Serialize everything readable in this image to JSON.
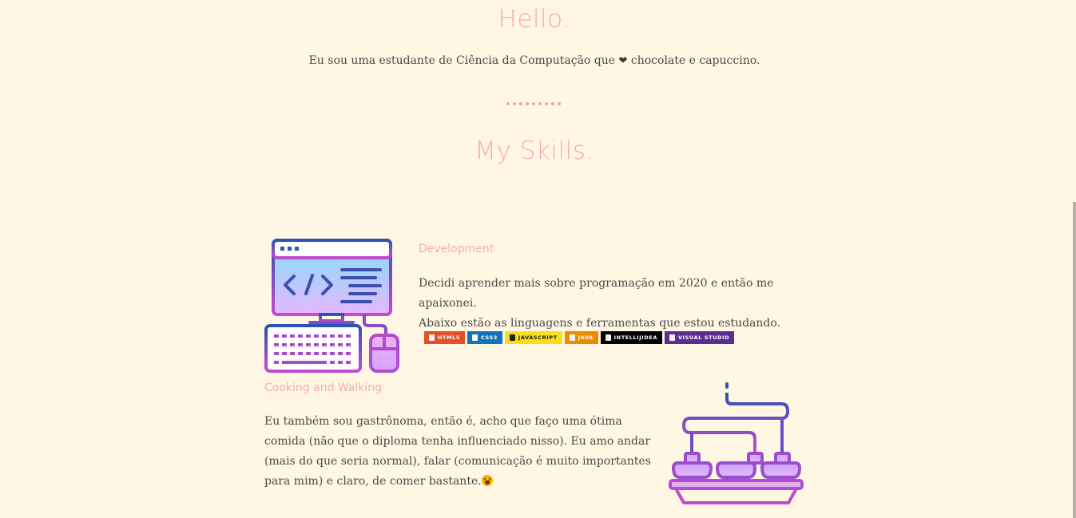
{
  "hello": {
    "title": "Hello.",
    "intro_before": "Eu sou uma estudante de Ciência da Computação que",
    "intro_heart": "❤",
    "intro_after": "chocolate e capuccino."
  },
  "skills": {
    "title": "My Skills."
  },
  "development": {
    "title": "Development",
    "line1": "Decidi aprender mais sobre programação em 2020 e então me apaixonei.",
    "line2": "Abaixo estão as linguagens e ferramentas que estou estudando.",
    "illustration_icon": "computer-code-icon",
    "badges": [
      {
        "label": "HTML5",
        "color": "#e34f26",
        "icon": "html5-icon"
      },
      {
        "label": "CSS3",
        "color": "#1572b6",
        "icon": "css3-icon"
      },
      {
        "label": "JAVASCRIPT",
        "color": "#f7df1e",
        "icon": "javascript-icon"
      },
      {
        "label": "JAVA",
        "color": "#ed8b00",
        "icon": "java-icon"
      },
      {
        "label": "INTELLIJIDEA",
        "color": "#000000",
        "icon": "intellij-icon"
      },
      {
        "label": "VISUAL STUDIO",
        "color": "#5c2d91",
        "icon": "visual-studio-icon"
      }
    ]
  },
  "cooking": {
    "title": "Cooking and Walking",
    "text": "Eu também sou gastrônoma, então é, acho que faço uma ótima comida (não que o diploma tenha influenciado nisso). Eu amo andar (mais do que seria normal), falar (comunicação é muito importantes para mim) e claro, de comer bastante.",
    "emoji": "hungry-face-emoji",
    "illustration_icon": "conveyor-food-icon"
  },
  "colors": {
    "background": "#fff7e4",
    "accent_pink": "#f7a9b3",
    "text": "#4a4848",
    "gradient_blue": "#2f55b8",
    "gradient_purple": "#c04bd0"
  }
}
